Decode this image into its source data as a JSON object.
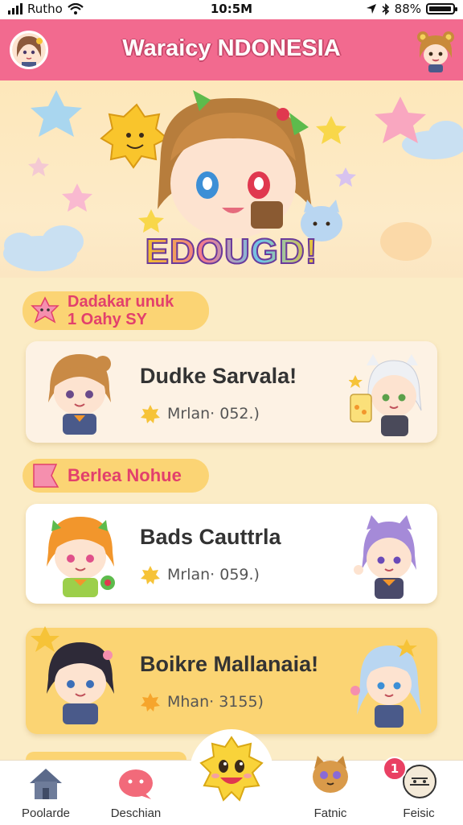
{
  "status_bar": {
    "carrier": "Rutho",
    "time": "10:5M",
    "battery": "88%"
  },
  "header": {
    "title": "Waraicy NDONESIA"
  },
  "hero": {
    "logo_text": "EDOUGD!"
  },
  "sections": [
    {
      "label_line1": "Dadakar unuk",
      "label_line2": "1 Oahy SY"
    },
    {
      "label_line1": "Berlea Nohue",
      "label_line2": ""
    }
  ],
  "cards": [
    {
      "title": "Dudke Sarvala!",
      "meta": "Mrlan· 052.)"
    },
    {
      "title": "Bads Cauttrla",
      "meta": "Mrlan· 059.)"
    },
    {
      "title": "Boikre Mallanaia!",
      "meta": "Mhan· 3155)"
    }
  ],
  "nav": {
    "items": [
      {
        "label": "Poolarde"
      },
      {
        "label": "Deschian"
      },
      {
        "label": "Fatnic"
      },
      {
        "label": "Feisic"
      }
    ],
    "badge_count": "1"
  },
  "colors": {
    "header": "#f26a8f",
    "background": "#fbecc6",
    "section_label": "#fbd474",
    "label_text": "#e2406c",
    "highlight_card": "#fbd473"
  }
}
